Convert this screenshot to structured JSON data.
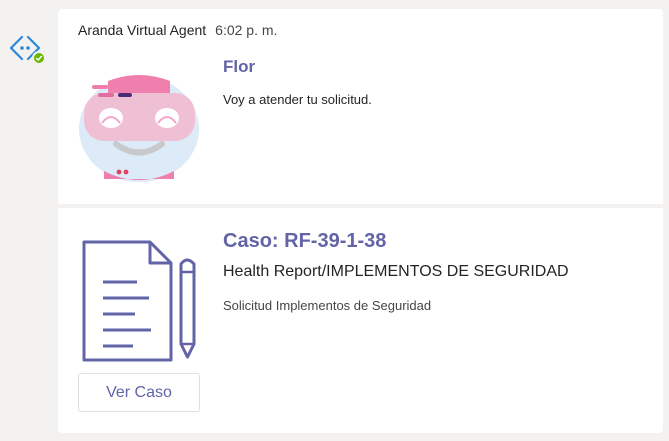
{
  "bot": {
    "name": "Aranda Virtual Agent",
    "timestamp": "6:02 p. m.",
    "avatar_icon": "bot-code-icon",
    "presence_icon": "available-check-icon",
    "accent_color": "#6264a7"
  },
  "intro_card": {
    "image": "flor-robot-face-icon",
    "title": "Flor",
    "text": "Voy a atender tu solicitud."
  },
  "case_card": {
    "image": "document-pencil-icon",
    "title": "Caso: RF-39-1-38",
    "subject": "Health Report/IMPLEMENTOS DE SEGURIDAD",
    "description": "Solicitud Implementos de Seguridad",
    "button_label": "Ver Caso"
  }
}
